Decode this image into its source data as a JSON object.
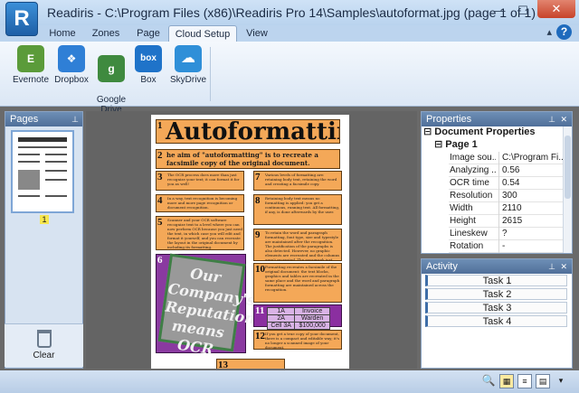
{
  "window": {
    "title": "Readiris - C:\\Program Files (x86)\\Readiris Pro 14\\Samples\\autoformat.jpg (page 1 of 1)",
    "logo": "R",
    "minimize": "—",
    "maximize": "☐",
    "close": "✕"
  },
  "tabs": [
    "Home",
    "Zones",
    "Page",
    "Cloud Setup",
    "View"
  ],
  "active_tab": "Cloud Setup",
  "help": "?",
  "ribbon": {
    "buttons": [
      {
        "label": "Evernote",
        "icon": "evernote-icon",
        "glyph": "E",
        "color": "#5b9b3a"
      },
      {
        "label": "Dropbox",
        "icon": "dropbox-icon",
        "glyph": "❖",
        "color": "#2f7fd6"
      },
      {
        "label": "Google\nDrive",
        "icon": "google-drive-icon",
        "glyph": "g",
        "color": "#3f8a3f"
      },
      {
        "label": "Box",
        "icon": "box-icon",
        "glyph": "box",
        "color": "#1f73c9"
      },
      {
        "label": "SkyDrive",
        "icon": "skydrive-icon",
        "glyph": "☁",
        "color": "#2f8fd8"
      }
    ]
  },
  "pages_panel": {
    "title": "Pages",
    "page_number": "1",
    "clear_label": "Clear"
  },
  "document": {
    "zones": [
      {
        "num": "1",
        "text": "Autoformatting"
      },
      {
        "num": "2",
        "text": "he aim of \"autoformatting\" is to recreate a facsimile copy of the original document."
      },
      {
        "num": "3",
        "text": "The OCR process does more than just recognize your text; it can format it for you as well!"
      },
      {
        "num": "4",
        "text": "In a way, text recognition is becoming more and more page recognition or document recognition."
      },
      {
        "num": "5",
        "text": "Scanner and your OCR software recognize text to a level where you can now perform OCR because you just need the text, in which case you will edit and format it yourself, and you can recreate the layout in the original document by including its formatting."
      },
      {
        "num": "6",
        "text": "Our Company's Reputation means OCR"
      },
      {
        "num": "7",
        "text": "Various levels of formatting are: retaining body text, retaining the word and creating a facsimile copy."
      },
      {
        "num": "8",
        "text": "Retaining body text means no formatting is applied: you get a continuous, running text. All formatting, if any, is done afterwards by the user."
      },
      {
        "num": "9",
        "text": "To retain the word and paragraph formatting, font type, size and typestyle are maintained after the recognition. The justification of the paragraphs is also detected. However, no graphic elements are recreated and the columns aren't recreated. The paragraph just follow each other."
      },
      {
        "num": "10",
        "text": "Formatting recreates a facsimile of the original document: the text blocks, graphics and tables are recreated in the same place and the word and paragraph formatting are maintained across the recognition."
      },
      {
        "num": "11",
        "text": ""
      },
      {
        "num": "12",
        "text": "If you get a true copy of your document, there is a compact and editable way; it's no longer a scanned image of your document."
      },
      {
        "num": "13",
        "text": ""
      }
    ],
    "table": {
      "rows": [
        [
          "1A",
          "Invoice"
        ],
        [
          "2A",
          "Warden"
        ],
        [
          "Cell 3A",
          "$100,000"
        ]
      ]
    }
  },
  "properties_panel": {
    "title": "Properties",
    "category": "Document Properties",
    "subcategory": "Page 1",
    "rows": [
      {
        "key": "Image sou...",
        "value": "C:\\Program Fi..."
      },
      {
        "key": "Analyzing ...",
        "value": "0.56"
      },
      {
        "key": "OCR time",
        "value": "0.54"
      },
      {
        "key": "Resolution",
        "value": "300"
      },
      {
        "key": "Width",
        "value": "2110"
      },
      {
        "key": "Height",
        "value": "2615"
      },
      {
        "key": "Lineskew",
        "value": "?"
      },
      {
        "key": "Rotation",
        "value": "-"
      }
    ]
  },
  "activity_panel": {
    "title": "Activity",
    "tasks": [
      "Task 1",
      "Task 2",
      "Task 3",
      "Task 4"
    ]
  },
  "pin_glyph": "📌",
  "close_glyph": "✕"
}
